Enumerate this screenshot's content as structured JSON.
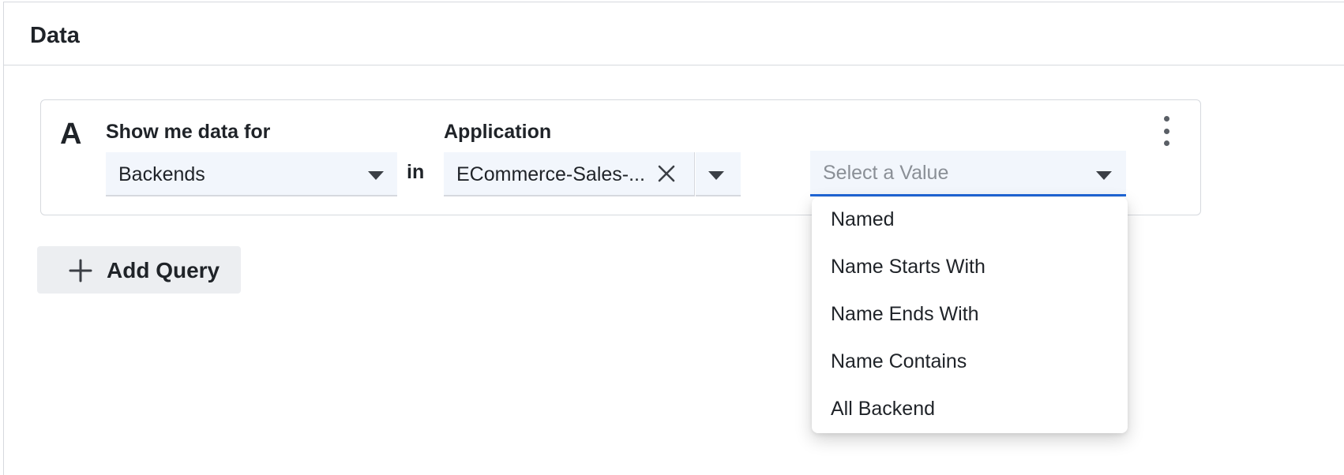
{
  "panel": {
    "title": "Data"
  },
  "query": {
    "letter": "A",
    "show_label": "Show me data for",
    "entity_value": "Backends",
    "in_text": "in",
    "scope_label": "Application",
    "scope_value": "ECommerce-Sales-...",
    "value_placeholder": "Select a Value"
  },
  "add_query": {
    "label": "Add Query"
  },
  "dropdown": {
    "options": [
      "Named",
      "Name Starts With",
      "Name Ends With",
      "Name Contains",
      "All Backend"
    ]
  },
  "colors": {
    "accent": "#1f66d6",
    "field_bg": "#f2f6fc",
    "button_bg": "#eceef1",
    "border": "#d6d9de",
    "placeholder": "#8a8f96"
  },
  "icons": {
    "caret": "chevron-down-icon",
    "clear": "close-icon",
    "more": "more-vertical-icon",
    "add": "plus-icon"
  }
}
